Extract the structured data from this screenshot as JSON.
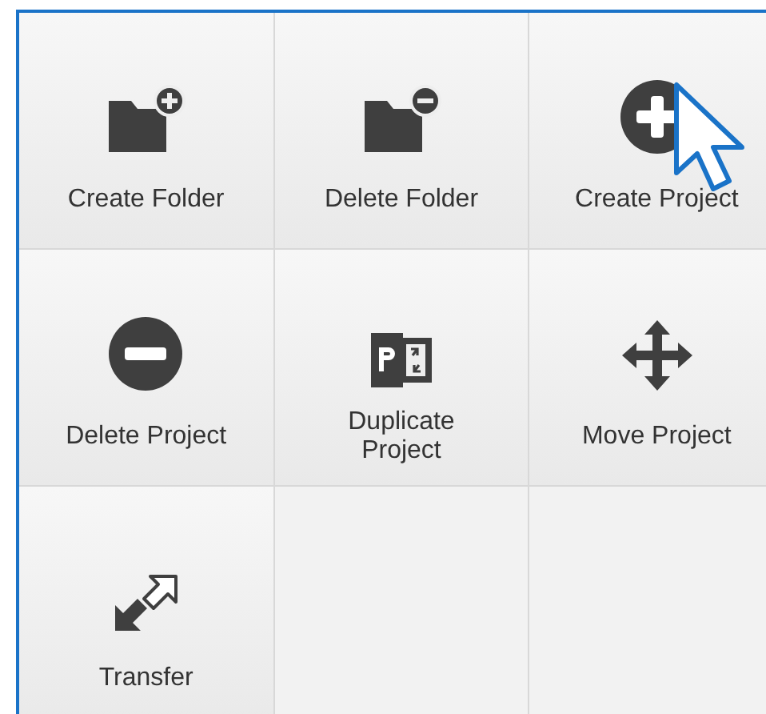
{
  "tiles": [
    {
      "label": "Create Folder",
      "kind": "folderplus"
    },
    {
      "label": "Delete Folder",
      "kind": "folderminus"
    },
    {
      "label": "Create Project",
      "kind": "plus"
    },
    {
      "label": "Delete Project",
      "kind": "minus"
    },
    {
      "label": "Duplicate Project",
      "kind": "duplicate"
    },
    {
      "label": "Move Project",
      "kind": "move"
    },
    {
      "label": "Transfer",
      "kind": "transfer"
    }
  ]
}
